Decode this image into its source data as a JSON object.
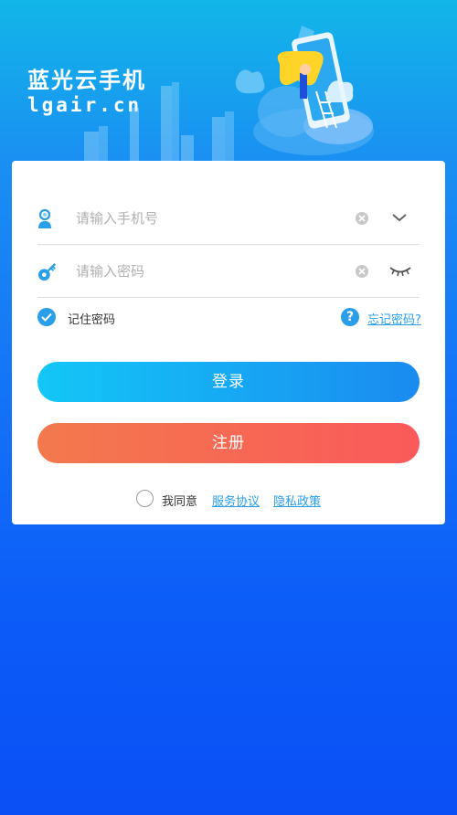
{
  "brand": {
    "name": "蓝光云手机",
    "domain": "lgair.cn"
  },
  "form": {
    "phone": {
      "placeholder": "请输入手机号",
      "value": ""
    },
    "password": {
      "placeholder": "请输入密码",
      "value": ""
    },
    "remember": {
      "label": "记住密码",
      "checked": true
    },
    "forgot_label": "忘记密码?",
    "help_glyph": "?"
  },
  "buttons": {
    "login": "登录",
    "register": "注册"
  },
  "agreement": {
    "prefix": "我同意",
    "terms": "服务协议",
    "privacy": "隐私政策",
    "checked": false
  },
  "icons": {
    "phone_field": "user-icon",
    "password_field": "key-icon",
    "clear": "clear-icon",
    "dropdown": "chevron-down-icon",
    "visibility": "eye-closed-icon",
    "remember": "check-icon",
    "forgot": "help-icon"
  },
  "colors": {
    "accent": "#2a9ee8",
    "login_gradient": [
      "#13c7f7",
      "#1a8bf0"
    ],
    "register_gradient": [
      "#f3794d",
      "#fa5a5a"
    ]
  }
}
